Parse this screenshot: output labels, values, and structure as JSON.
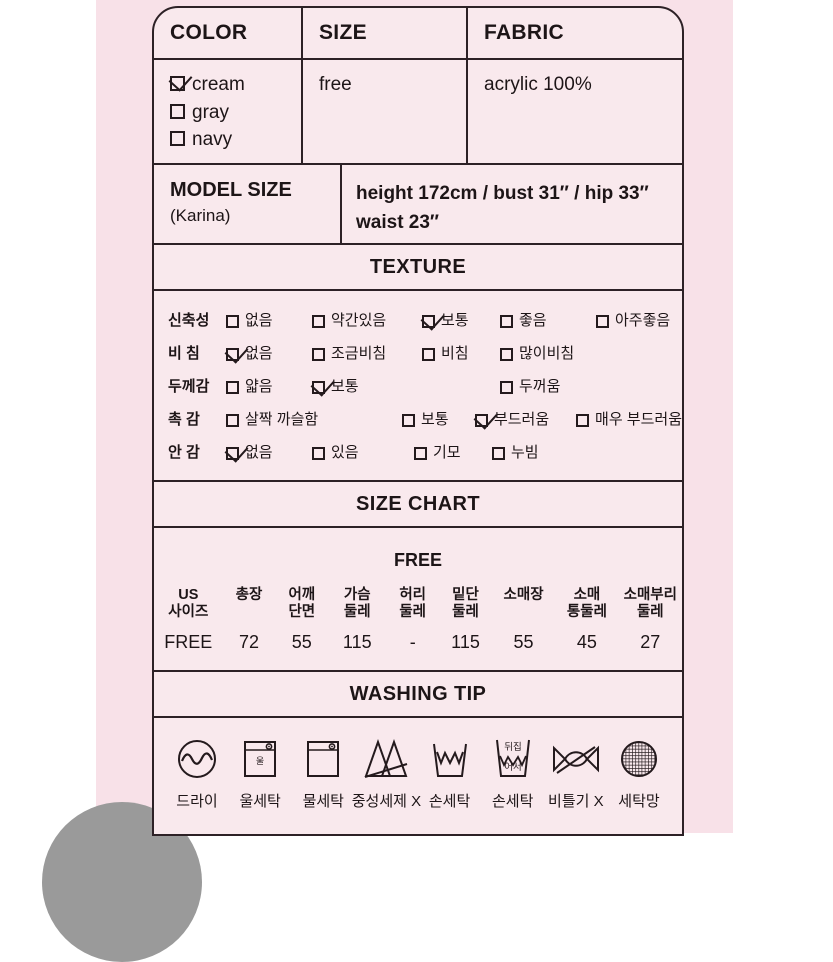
{
  "colors": {
    "page_background": "#ffffff",
    "photo_background": "#f8e1e8",
    "card_background": "#f9e9ed",
    "border": "#2d2126",
    "text": "#1d1517",
    "blob": "#9a9a9a"
  },
  "spec_table": {
    "headers": [
      "COLOR",
      "SIZE",
      "FABRIC"
    ],
    "color_options": [
      {
        "label": "cream",
        "checked": true
      },
      {
        "label": "gray",
        "checked": false
      },
      {
        "label": "navy",
        "checked": false
      }
    ],
    "size_value": "free",
    "fabric_value": "acrylic 100%"
  },
  "model_size": {
    "label": "MODEL SIZE",
    "name": "(Karina)",
    "line1": "height 172cm / bust 31″ / hip 33″",
    "line2": "waist 23″"
  },
  "texture": {
    "banner": "TEXTURE",
    "rows": [
      {
        "label": "신축성",
        "options": [
          {
            "label": "없음",
            "checked": false
          },
          {
            "label": "약간있음",
            "checked": false
          },
          {
            "label": "보통",
            "checked": true
          },
          {
            "label": "좋음",
            "checked": false
          },
          {
            "label": "아주좋음",
            "checked": false
          }
        ]
      },
      {
        "label": "비 침",
        "options": [
          {
            "label": "없음",
            "checked": true
          },
          {
            "label": "조금비침",
            "checked": false
          },
          {
            "label": "비침",
            "checked": false
          },
          {
            "label": "많이비침",
            "checked": false
          }
        ]
      },
      {
        "label": "두께감",
        "options": [
          {
            "label": "얇음",
            "checked": false
          },
          {
            "label": "보통",
            "checked": true
          },
          {
            "label": "두꺼움",
            "checked": false
          }
        ]
      },
      {
        "label": "촉 감",
        "options": [
          {
            "label": "살짝 까슬함",
            "checked": false
          },
          {
            "label": "보통",
            "checked": false
          },
          {
            "label": "부드러움",
            "checked": true
          },
          {
            "label": "매우 부드러움",
            "checked": false
          }
        ]
      },
      {
        "label": "안 감",
        "options": [
          {
            "label": "없음",
            "checked": true
          },
          {
            "label": "있음",
            "checked": false
          },
          {
            "label": "기모",
            "checked": false
          },
          {
            "label": "누빔",
            "checked": false
          }
        ]
      }
    ]
  },
  "size_chart": {
    "banner": "SIZE CHART",
    "subtitle": "FREE",
    "headers": [
      "US\n사이즈",
      "총장",
      "어깨\n단면",
      "가슴\n둘레",
      "허리\n둘레",
      "밑단\n둘레",
      "소매장",
      "소매\n통둘레",
      "소매부리\n둘레"
    ],
    "rows": [
      [
        "FREE",
        "72",
        "55",
        "115",
        "-",
        "115",
        "55",
        "45",
        "27"
      ]
    ]
  },
  "washing_tip": {
    "banner": "WASHING TIP",
    "items": [
      {
        "icon": "dry-clean-icon",
        "label": "드라이"
      },
      {
        "icon": "wool-wash-icon",
        "label": "울세탁"
      },
      {
        "icon": "machine-wash-icon",
        "label": "물세탁"
      },
      {
        "icon": "no-neutral-detergent-icon",
        "label": "중성세제 X"
      },
      {
        "icon": "hand-wash-icon",
        "label": "손세탁"
      },
      {
        "icon": "hand-wash-inside-out-icon",
        "label": "손세탁"
      },
      {
        "icon": "no-wring-icon",
        "label": "비틀기 X"
      },
      {
        "icon": "laundry-net-icon",
        "label": "세탁망"
      }
    ],
    "inside_out_text_top": "뒤집",
    "inside_out_text_bottom": "어서"
  }
}
